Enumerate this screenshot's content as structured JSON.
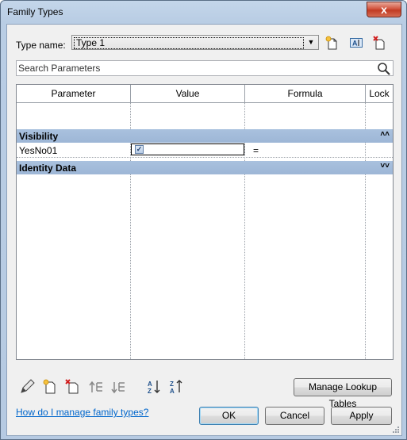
{
  "window": {
    "title": "Family Types",
    "close_glyph": "x"
  },
  "type_name": {
    "label": "Type name:",
    "selected": "Type 1",
    "icons": [
      "new-type-icon",
      "rename-type-icon",
      "delete-type-icon"
    ]
  },
  "search": {
    "placeholder": "Search Parameters",
    "icon": "search-icon"
  },
  "table": {
    "columns": [
      "Parameter",
      "Value",
      "Formula",
      "Lock"
    ],
    "groups": [
      {
        "name": "Visibility",
        "expanded": true,
        "chevron": "collapse-up-icon"
      },
      {
        "name": "Identity Data",
        "expanded": false,
        "chevron": "expand-down-icon"
      }
    ],
    "rows": [
      {
        "parameter": "YesNo01",
        "value_checked": true,
        "formula": "=",
        "lock": ""
      }
    ]
  },
  "bottom_toolbar": {
    "icons": [
      "edit-parameter-icon",
      "new-parameter-icon",
      "delete-parameter-icon",
      "move-up-icon",
      "move-down-icon",
      "sort-ascending-icon",
      "sort-descending-icon"
    ],
    "manage_lookup_label": "Manage Lookup Tables"
  },
  "help_link": "How do I manage family types?",
  "buttons": {
    "ok": "OK",
    "cancel": "Cancel",
    "apply": "Apply"
  },
  "colors": {
    "group_header": "#a9c1de",
    "link": "#0066cc",
    "close_button": "#c13b23"
  }
}
